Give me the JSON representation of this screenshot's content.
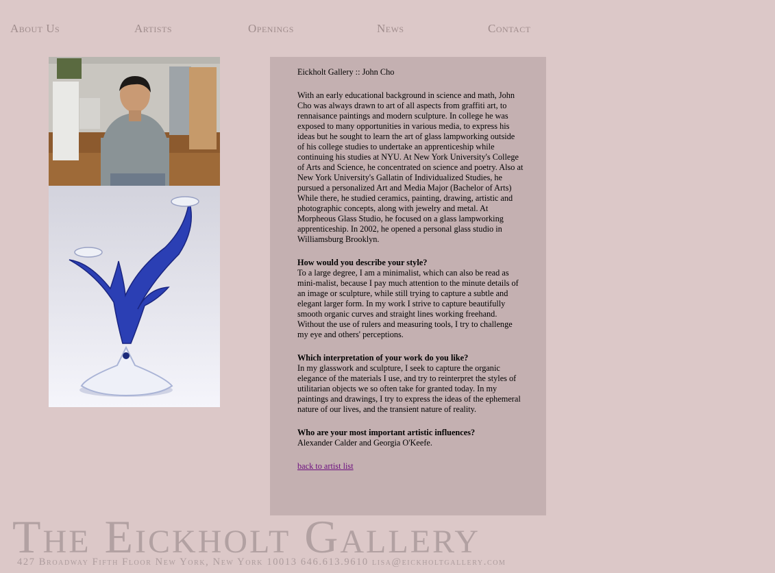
{
  "nav": {
    "items": [
      "About Us",
      "Artists",
      "Openings",
      "News",
      "Contact"
    ]
  },
  "images": {
    "portrait": "artist-portrait",
    "sculpture": "blue-glass-sculpture"
  },
  "panel": {
    "heading": "Eickholt Gallery :: John Cho",
    "bio": "With an early educational background in science and math, John Cho was always drawn to art of all aspects from graffiti art, to rennaisance paintings and modern sculpture. In college he was exposed to many opportunities in various media, to express his ideas but he sought to learn the art of glass lampworking outside of his college studies to undertake an apprenticeship while continuing his studies at NYU. At New York University's College of Arts and Science, he concentrated on science and poetry. Also at New York University's Gallatin of Individualized Studies, he pursued a personalized Art and Media Major (Bachelor of Arts) While there, he studied ceramics, painting, drawing, artistic and photographic concepts, along with jewelry and metal. At Morpheous Glass Studio, he focused on a glass lampworking apprenticeship. In 2002, he opened a personal glass studio in Williamsburg Brooklyn.",
    "qa": [
      {
        "q": "How would you describe your style?",
        "a": "To a large degree, I am a minimalist, which can also be read as mini-malist, because I pay much attention to the minute details of an image or sculpture, while still trying to capture a subtle and elegant larger form. In my work I strive to capture beautifully smooth organic curves and straight lines working freehand. Without the use of rulers and measuring tools, I try to challenge my eye and others' perceptions."
      },
      {
        "q": "Which interpretation of your work do you like?",
        "a": "In my glasswork and sculpture, I seek to capture the organic elegance of the materials I use, and try to reinterpret the styles of utilitarian objects we so often take for granted today. In my paintings and drawings, I try to express the ideas of the ephemeral nature of our lives, and the transient nature of reality."
      },
      {
        "q": "Who are your most important artistic influences?",
        "a": "Alexander Calder and Georgia O'Keefe."
      }
    ],
    "back_link": "back to artist list"
  },
  "footer": {
    "title": "The Eickholt Gallery",
    "address": "427 Broadway Fifth Floor New York, New York 10013 646.613.9610 lisa@eickholtgallery.com"
  },
  "colors": {
    "background": "#dcc8c8",
    "panel": "#c4b0b1",
    "nav_text": "#9f8c8c",
    "link": "#6b0d7e"
  }
}
